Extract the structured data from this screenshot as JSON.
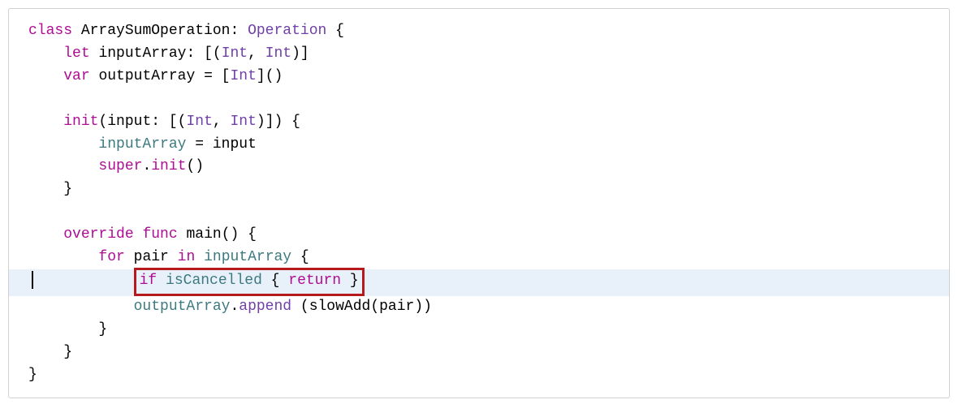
{
  "code": {
    "line1": {
      "kw_class": "class",
      "name": "ArraySumOperation",
      "colon": ": ",
      "type": "Operation",
      "open": " {"
    },
    "line2": {
      "indent": "    ",
      "kw_let": "let",
      "sp": " ",
      "name": "inputArray",
      "colon": ": [(",
      "int1": "Int",
      "comma": ", ",
      "int2": "Int",
      "close": ")]"
    },
    "line3": {
      "indent": "    ",
      "kw_var": "var",
      "sp": " ",
      "name": "outputArray",
      "eq": " = [",
      "int": "Int",
      "close": "]()"
    },
    "line4": {
      "empty": ""
    },
    "line5": {
      "indent": "    ",
      "kw_init": "init",
      "open": "(input: [(",
      "int1": "Int",
      "comma": ", ",
      "int2": "Int",
      "close": ")]) {"
    },
    "line6": {
      "indent": "        ",
      "name": "inputArray",
      "rest": " = input"
    },
    "line7": {
      "indent": "        ",
      "kw_super": "super",
      "dot": ".",
      "kw_init": "init",
      "parens": "()"
    },
    "line8": {
      "indent": "    ",
      "brace": "}"
    },
    "line9": {
      "empty": ""
    },
    "line10": {
      "indent": "    ",
      "kw_override": "override",
      "sp1": " ",
      "kw_func": "func",
      "sp2": " ",
      "name": "main",
      "parens": "() {"
    },
    "line11": {
      "indent": "        ",
      "kw_for": "for",
      "sp1": " ",
      "pair": "pair",
      "sp2": " ",
      "kw_in": "in",
      "sp3": " ",
      "name": "inputArray",
      "open": " {"
    },
    "line12": {
      "indent": "            ",
      "kw_if": "if",
      "sp1": " ",
      "name": "isCancelled",
      "sp2": " { ",
      "kw_return": "return",
      "close": " }"
    },
    "line13": {
      "indent": "            ",
      "name": "outputArray",
      "dot": ".",
      "append": "append",
      "sp": " (",
      "slowadd": "slowAdd",
      "open": "(",
      "pair": "pair",
      "close": "))"
    },
    "line14": {
      "indent": "        ",
      "brace": "}"
    },
    "line15": {
      "indent": "    ",
      "brace": "}"
    },
    "line16": {
      "brace": "}"
    }
  }
}
